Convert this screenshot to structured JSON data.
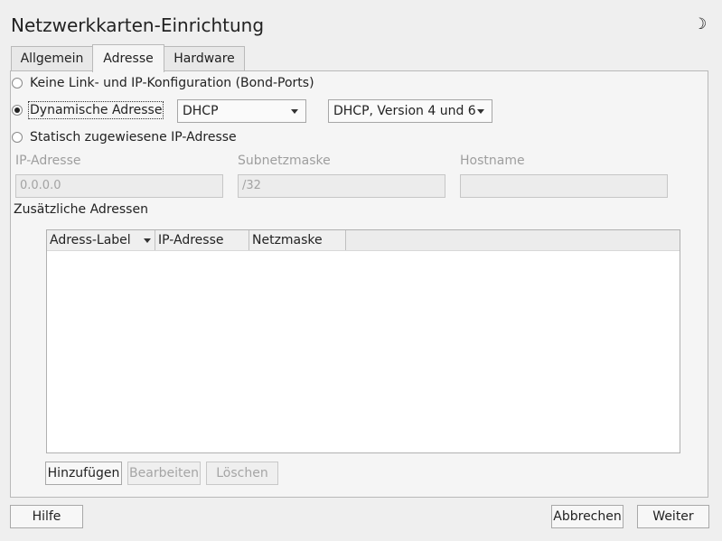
{
  "window": {
    "title": "Netzwerkkarten-Einrichtung",
    "icon": "moon-icon"
  },
  "tabs": [
    {
      "label": "Allgemein",
      "active": false
    },
    {
      "label": "Adresse",
      "active": true
    },
    {
      "label": "Hardware",
      "active": false
    }
  ],
  "address_mode": {
    "options": [
      {
        "label": "Keine Link- und IP-Konfiguration (Bond-Ports)",
        "selected": false
      },
      {
        "label": "Dynamische Adresse",
        "selected": true
      },
      {
        "label": "Statisch zugewiesene IP-Adresse",
        "selected": false
      }
    ],
    "dhcp_type": "DHCP",
    "dhcp_version": "DHCP, Version 4 und 6"
  },
  "static": {
    "ip_label": "IP-Adresse",
    "ip_value": "0.0.0.0",
    "netmask_label": "Subnetzmaske",
    "netmask_value": "/32",
    "hostname_label": "Hostname",
    "hostname_value": ""
  },
  "additional": {
    "heading": "Zusätzliche Adressen",
    "columns": [
      "Adress-Label",
      "IP-Adresse",
      "Netzmaske"
    ],
    "rows": [],
    "buttons": {
      "add": "Hinzufügen",
      "edit": "Bearbeiten",
      "delete": "Löschen"
    }
  },
  "footer": {
    "help": "Hilfe",
    "cancel": "Abbrechen",
    "next": "Weiter"
  }
}
